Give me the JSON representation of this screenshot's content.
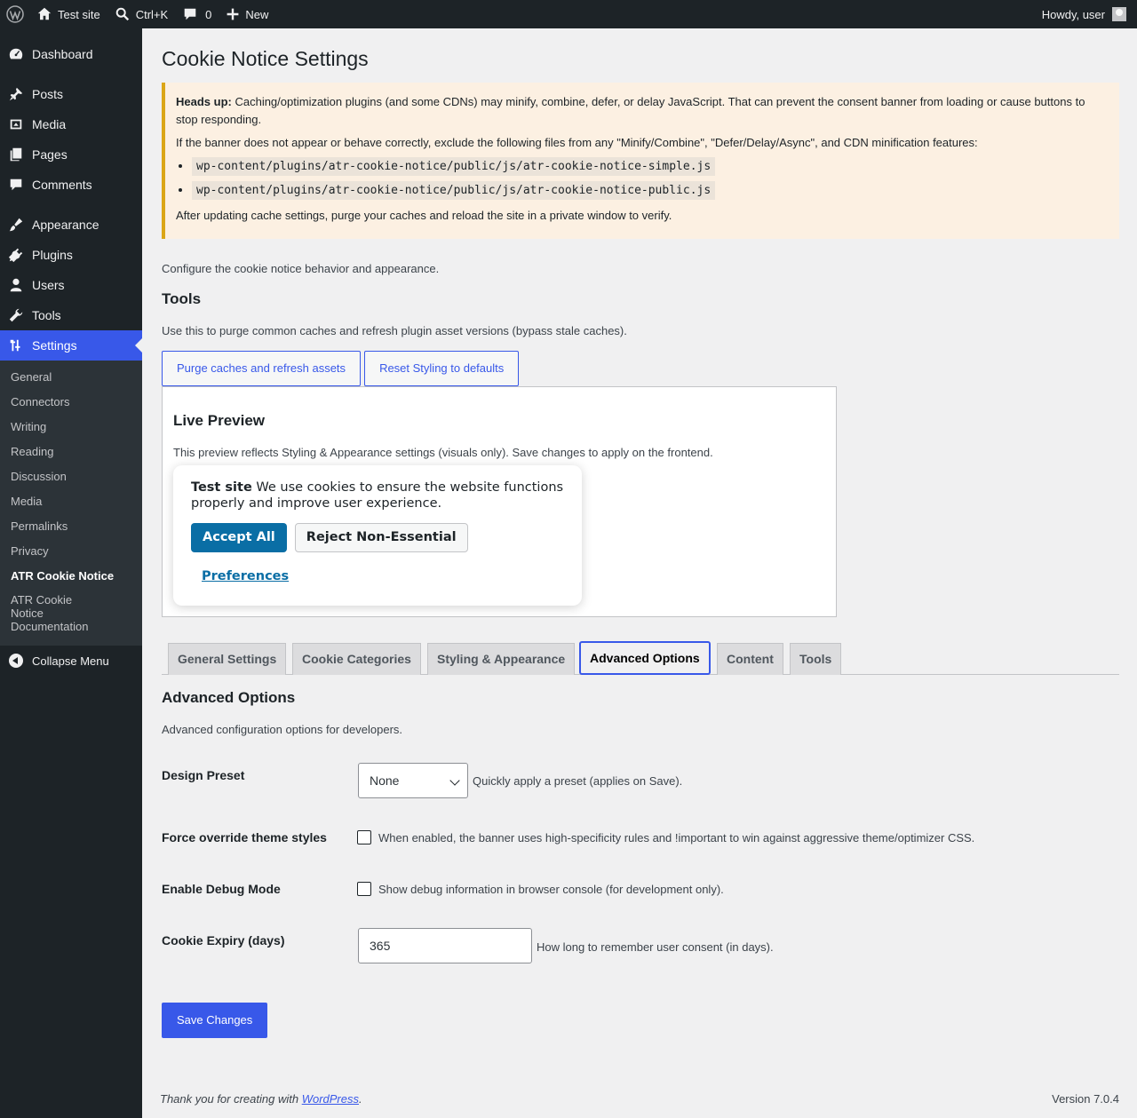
{
  "adminbar": {
    "site_name": "Test site",
    "search_shortcut": "Ctrl+K",
    "comments_count": "0",
    "new_label": "New",
    "howdy": "Howdy, user"
  },
  "sidebar": {
    "items": [
      {
        "label": "Dashboard",
        "icon": "dashboard-icon"
      },
      {
        "label": "Posts",
        "icon": "pin-icon"
      },
      {
        "label": "Media",
        "icon": "media-icon"
      },
      {
        "label": "Pages",
        "icon": "pages-icon"
      },
      {
        "label": "Comments",
        "icon": "comment-icon"
      },
      {
        "label": "Appearance",
        "icon": "brush-icon"
      },
      {
        "label": "Plugins",
        "icon": "plugin-icon"
      },
      {
        "label": "Users",
        "icon": "user-icon"
      },
      {
        "label": "Tools",
        "icon": "wrench-icon"
      },
      {
        "label": "Settings",
        "icon": "settings-icon"
      }
    ],
    "settings_submenu": [
      "General",
      "Connectors",
      "Writing",
      "Reading",
      "Discussion",
      "Media",
      "Permalinks",
      "Privacy",
      "ATR Cookie Notice",
      "ATR Cookie Notice Documentation"
    ],
    "collapse_label": "Collapse Menu"
  },
  "page": {
    "title": "Cookie Notice Settings",
    "notice": {
      "heads_up": "Heads up:",
      "line1": "Caching/optimization plugins (and some CDNs) may minify, combine, defer, or delay JavaScript. That can prevent the consent banner from loading or cause buttons to stop responding.",
      "line2": "If the banner does not appear or behave correctly, exclude the following files from any \"Minify/Combine\", \"Defer/Delay/Async\", and CDN minification features:",
      "files": [
        "wp-content/plugins/atr-cookie-notice/public/js/atr-cookie-notice-simple.js",
        "wp-content/plugins/atr-cookie-notice/public/js/atr-cookie-notice-public.js"
      ],
      "line3": "After updating cache settings, purge your caches and reload the site in a private window to verify."
    },
    "configure_desc": "Configure the cookie notice behavior and appearance.",
    "tools_heading": "Tools",
    "tools_desc": "Use this to purge common caches and refresh plugin asset versions (bypass stale caches).",
    "purge_button": "Purge caches and refresh assets",
    "reset_button": "Reset Styling to defaults",
    "preview": {
      "heading": "Live Preview",
      "desc": "This preview reflects Styling & Appearance settings (visuals only). Save changes to apply on the frontend.",
      "site_name": "Test site",
      "message": "We use cookies to ensure the website functions properly and improve user experience.",
      "accept": "Accept All",
      "reject": "Reject Non-Essential",
      "preferences": "Preferences"
    },
    "tabs": [
      "General Settings",
      "Cookie Categories",
      "Styling & Appearance",
      "Advanced Options",
      "Content",
      "Tools"
    ],
    "active_tab": "Advanced Options",
    "advanced": {
      "heading": "Advanced Options",
      "desc": "Advanced configuration options for developers.",
      "design_preset_label": "Design Preset",
      "design_preset_value": "None",
      "design_preset_desc": "Quickly apply a preset (applies on Save).",
      "force_override_label": "Force override theme styles",
      "force_override_checked": false,
      "force_override_desc": "When enabled, the banner uses high-specificity rules and !important to win against aggressive theme/optimizer CSS.",
      "debug_label": "Enable Debug Mode",
      "debug_checked": false,
      "debug_desc": "Show debug information in browser console (for development only).",
      "expiry_label": "Cookie Expiry (days)",
      "expiry_value": "365",
      "expiry_desc": "How long to remember user consent (in days)."
    },
    "save_button": "Save Changes"
  },
  "footer": {
    "thanks": "Thank you for creating with",
    "link": "WordPress",
    "period": ".",
    "version": "Version 7.0.4"
  },
  "colors": {
    "accent": "#3858e9",
    "sidebar_bg": "#1d2327",
    "notice_border": "#dba617",
    "cookie_button": "#0a6ea5"
  }
}
